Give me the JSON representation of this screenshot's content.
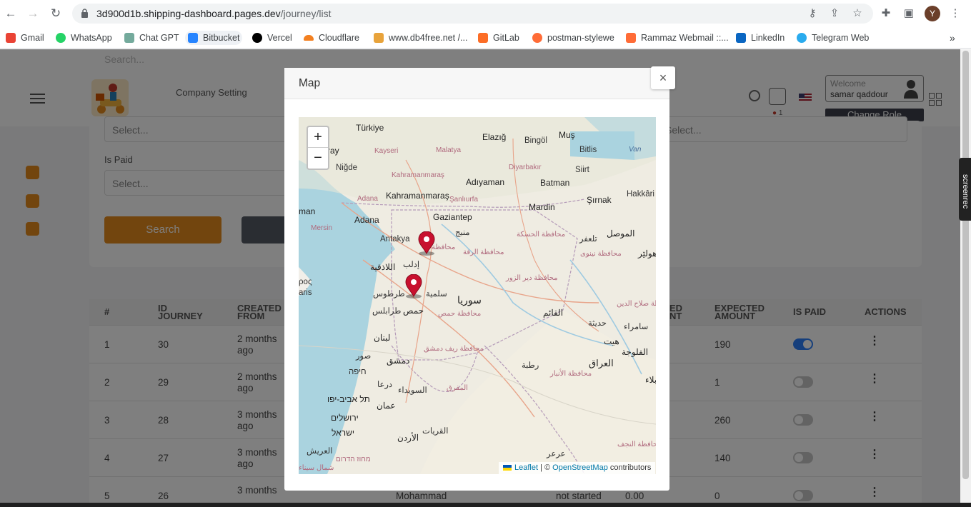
{
  "browser": {
    "url_domain": "3d900d1b.shipping-dashboard.pages.dev",
    "url_path": "/journey/list",
    "profile_initial": "Y",
    "bookmarks": [
      {
        "label": "Gmail",
        "color": "#ea4335"
      },
      {
        "label": "WhatsApp",
        "color": "#25d366"
      },
      {
        "label": "Chat GPT",
        "color": "#74aa9c"
      },
      {
        "label": "Bitbucket",
        "color": "#2684ff"
      },
      {
        "label": "Vercel",
        "color": "#000000"
      },
      {
        "label": "Cloudflare",
        "color": "#f38020"
      },
      {
        "label": "www.db4free.net /...",
        "color": "#e8a33b"
      },
      {
        "label": "GitLab",
        "color": "#fc6d26"
      },
      {
        "label": "postman-stylewe",
        "color": "#ff6c37"
      },
      {
        "label": "Rammaz Webmail ::...",
        "color": "#ff6c37"
      },
      {
        "label": "LinkedIn",
        "color": "#0a66c2"
      },
      {
        "label": "Telegram Web",
        "color": "#2aabee"
      }
    ],
    "more_bookmarks_icon": "chevron-double-right-icon"
  },
  "header": {
    "search_placeholder": "Search...",
    "company_setting": "Company Setting",
    "notification_count": "1",
    "welcome_label": "Welcome",
    "user_name": "samar qaddour",
    "change_role": "Change Role"
  },
  "filters": {
    "top_select_left": "Select...",
    "top_select_right": "Select...",
    "is_paid_label": "Is Paid",
    "is_paid_placeholder": "Select...",
    "search_button": "Search"
  },
  "table": {
    "headers": {
      "num": "#",
      "id_journey_1": "ID",
      "id_journey_2": "JOURNEY",
      "created_from_1": "CREATED",
      "created_from_2": "FROM",
      "received_1": "ED",
      "received_2": "NT",
      "expected_amount_1": "EXPECTED",
      "expected_amount_2": "AMOUNT",
      "is_paid": "IS PAID",
      "actions": "ACTIONS"
    },
    "rows": [
      {
        "num": "1",
        "id": "30",
        "created_1": "2 months",
        "created_2": "ago",
        "expected": "190",
        "paid": true
      },
      {
        "num": "2",
        "id": "29",
        "created_1": "2 months",
        "created_2": "ago",
        "expected": "1",
        "paid": false
      },
      {
        "num": "3",
        "id": "28",
        "created_1": "3 months",
        "created_2": "ago",
        "expected": "260",
        "paid": false
      },
      {
        "num": "4",
        "id": "27",
        "created_1": "3 months",
        "created_2": "ago",
        "expected": "140",
        "paid": false
      },
      {
        "num": "5",
        "id": "26",
        "created_1": "3 months",
        "created_2": "",
        "expected": "0",
        "paid": false,
        "name": "Mohammad",
        "status": "not started",
        "amount": "0.00"
      }
    ]
  },
  "modal": {
    "title": "Map",
    "close": "×",
    "zoom_in": "+",
    "zoom_out": "−",
    "attribution_leaflet": "Leaflet",
    "attribution_sep": " | © ",
    "attribution_osm": "OpenStreetMap",
    "attribution_tail": " contributors",
    "labels": {
      "turkiye": "Türkiye",
      "elazig": "Elazığ",
      "mus": "Muş",
      "bingol": "Bingöl",
      "bitlis": "Bitlis",
      "van": "Van",
      "kayseri": "Kayseri",
      "malatya": "Malatya",
      "diyarbakir": "Diyarbakır",
      "siirt": "Siirt",
      "nigde": "Niğde",
      "kahramanmaras_region": "Kahramanmaraş",
      "adiyaman": "Adıyaman",
      "batman": "Batman",
      "hakkari": "Hakkâri",
      "adana_region": "Adana",
      "sanliurfa": "Şanlıurfa",
      "sirnak": "Şırnak",
      "kahramanmaras": "Kahramanmaraş",
      "mardin": "Mardin",
      "gaziantep": "Gaziantep",
      "adana": "Adana",
      "mersin": "Mersin",
      "antakya": "Antakya",
      "manbij": "منبج",
      "hasakah_gov": "محافظة الحسكة",
      "tel_afar": "تلعفر",
      "mosul": "الموصل",
      "aleppo_gov": "محافظة",
      "raqqa_gov": "محافظة الرقة",
      "nineveh_gov": "محافظة نينوى",
      "erbil": "هولێر",
      "idlib": "إدلب",
      "latakia": "اللاذقية",
      "deir_gov": "محافظة دير الزور",
      "tartus": "طرطوس",
      "salamiyah": "سلمية",
      "syria": "سوريا",
      "homs_gov": "محافظة حمص",
      "homs": "حمص",
      "tartus2": "طرابلس",
      "alqaim": "القائم",
      "haditha": "حديثة",
      "samarra": "سامراء",
      "salahuddin": "محافظة صلاح الدين",
      "lebanon": "لبنان",
      "hit": "هيت",
      "fallujah": "الفلوجة",
      "tyre": "صور",
      "damascus": "دمشق",
      "rif_dimashq": "محافظة ريف دمشق",
      "rutba": "رطبة",
      "iraq": "العراق",
      "anbar_gov": "محافظة الأنبار",
      "haifa": "חיפה",
      "daraa": "درعا",
      "sweida": "السويداء",
      "mafraq": "المفرق",
      "karbala": "كربلاء",
      "tel_aviv": "תל אביב-יפו",
      "amman": "عمان",
      "jerusalem": "ירושלים",
      "qurayyat": "القريات",
      "israel": "ישראל",
      "jordan": "الأردن",
      "najaf_gov": "محافظة النجف",
      "arish": "العريش",
      "ararr": "عرعر",
      "mahoz_hadarom": "מחוז הדרום",
      "north_sinai": "شمال سيناء",
      "ray": "ray",
      "man": "man",
      "aris": "aris",
      "roc": "ρος"
    }
  },
  "extension": {
    "label": "screenrec"
  }
}
